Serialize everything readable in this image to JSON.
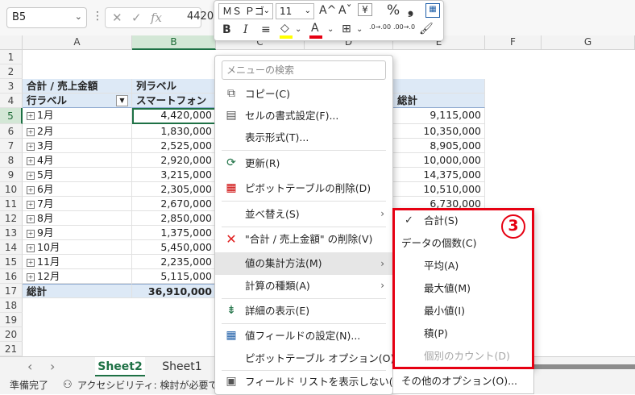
{
  "formula_bar": {
    "name_box": "B5",
    "cancel_icon": "✕",
    "enter_icon": "✓",
    "fx": "fx",
    "value": "4420"
  },
  "grid": {
    "columns": [
      "A",
      "B",
      "C",
      "D",
      "E",
      "F",
      "G"
    ],
    "rows": [
      "1",
      "2",
      "3",
      "4",
      "5",
      "6",
      "7",
      "8",
      "9",
      "10",
      "11",
      "12",
      "13",
      "14",
      "15",
      "16",
      "17",
      "18",
      "19",
      "20",
      "21"
    ],
    "pivot": {
      "row3_label": "合計 / 売上金額",
      "row3_col_label": "列ラベル",
      "row4_row_label": "行ラベル",
      "row4_b": "スマートフォン",
      "row4_total": "総計",
      "months": [
        "1月",
        "2月",
        "3月",
        "4月",
        "5月",
        "6月",
        "7月",
        "8月",
        "9月",
        "10月",
        "11月",
        "12月"
      ],
      "b_values": [
        "4,420,000",
        "1,830,000",
        "2,525,000",
        "2,920,000",
        "3,215,000",
        "2,305,000",
        "2,670,000",
        "2,850,000",
        "1,375,000",
        "5,450,000",
        "2,235,000",
        "5,115,000"
      ],
      "e_values": [
        "9,115,000",
        "10,350,000",
        "8,905,000",
        "10,000,000",
        "14,375,000",
        "10,510,000",
        "6,730,000"
      ],
      "total_label": "総計",
      "total_b": "36,910,000"
    }
  },
  "mini_toolbar": {
    "font_name": "ＭＳ Ｐゴ",
    "font_size": "11",
    "grow_font": "A^",
    "shrink_font": "Aˇ",
    "percent": "%",
    "comma": "❟",
    "bold": "B",
    "italic": "I",
    "align": "≡",
    "fill_label": "◇",
    "font_color_label": "A",
    "border": "⊞",
    "inc_decimal": ".0→.00",
    "dec_decimal": ".00→.0",
    "brush": "🖌",
    "fill_color": "#ffff00",
    "font_color": "#e60012"
  },
  "context_menu": {
    "search_placeholder": "メニューの検索",
    "items": [
      {
        "label": "コピー(C)"
      },
      {
        "label": "セルの書式設定(F)..."
      },
      {
        "label": "表示形式(T)..."
      },
      {
        "label": "更新(R)"
      },
      {
        "label": "ピボットテーブルの削除(D)"
      },
      {
        "label": "並べ替え(S)"
      },
      {
        "label": "\"合計 / 売上金額\" の削除(V)"
      },
      {
        "label": "値の集計方法(M)"
      },
      {
        "label": "計算の種類(A)"
      },
      {
        "label": "詳細の表示(E)"
      },
      {
        "label": "値フィールドの設定(N)..."
      },
      {
        "label": "ピボットテーブル オプション(O)..."
      },
      {
        "label": "フィールド リストを表示しない(D)"
      }
    ],
    "submenu_arrow": "›"
  },
  "submenu": {
    "check": "✓",
    "items": [
      {
        "label": "合計(S)"
      },
      {
        "label": "データの個数(C)"
      },
      {
        "label": "平均(A)"
      },
      {
        "label": "最大値(M)"
      },
      {
        "label": "最小値(I)"
      },
      {
        "label": "積(P)"
      },
      {
        "label": "個別のカウント(D)"
      }
    ],
    "other_options": "その他のオプション(O)...",
    "badge": "3"
  },
  "sheet_tabs": {
    "prev": "‹",
    "next": "›",
    "tabs": [
      "Sheet2",
      "Sheet1"
    ]
  },
  "status_bar": {
    "ready": "準備完了",
    "accessibility": "アクセシビリティ: 検討が必要です"
  },
  "colors": {
    "accent": "#1e7145",
    "highlight_frame": "#e60012",
    "pivot_header": "#dde9f6"
  }
}
